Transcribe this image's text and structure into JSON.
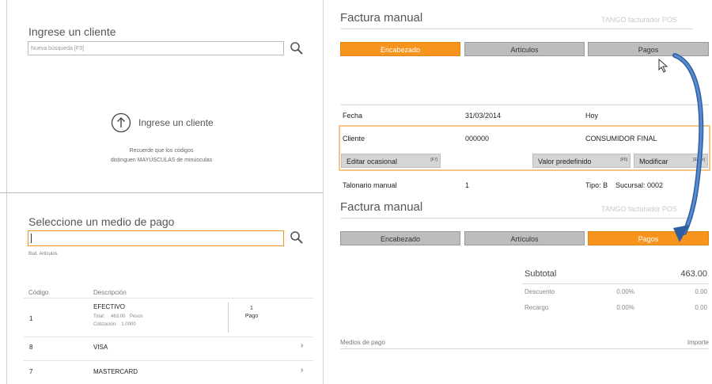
{
  "left_top": {
    "title": "Ingrese un cliente",
    "search_placeholder": "Nueva búsqueda [F3]",
    "prompt": "Ingrese un cliente",
    "hint_line1": "Recuerde que los códigos",
    "hint_line2": "distinguen MAYÚSCULAS de minúsculas"
  },
  "left_bottom": {
    "title": "Seleccione un medio de pago",
    "search_value": "",
    "filter_hint": "Bsd. Artículos",
    "columns": [
      "Código",
      "Descripción"
    ],
    "items": [
      {
        "code": "1",
        "name": "EFECTIVO",
        "total_label": "Total:",
        "total_value": "463.00",
        "currency": "Pesos",
        "rate_label": "Cotización:",
        "rate_value": "1.0000",
        "count": "1",
        "count_label": "Pago"
      },
      {
        "code": "8",
        "name": "VISA",
        "chevron": "›"
      },
      {
        "code": "7",
        "name": "MASTERCARD",
        "chevron": "›"
      }
    ]
  },
  "top_window": {
    "title": "Factura manual",
    "brand": "TANGO facturador POS",
    "tabs": [
      "Encabezado",
      "Artículos",
      "Pagos"
    ],
    "active_tab": 0,
    "fecha_label": "Fecha",
    "fecha_value": "31/03/2014",
    "fecha_hint": "Hoy",
    "cliente_label": "Cliente",
    "cliente_code": "000000",
    "cliente_name": "CONSUMIDOR FINAL",
    "btn_editar": "Editar ocasional",
    "btn_editar_key": "[F7]",
    "btn_valor": "Valor predefinido",
    "btn_valor_key": "[F5]",
    "btn_modificar": "Modificar",
    "btn_modificar_key": "[Enter]",
    "talonario_label": "Talonario manual",
    "talonario_value": "1",
    "tipo": "Tipo: B",
    "sucursal": "Sucursal: 0002"
  },
  "bottom_window": {
    "title": "Factura manual",
    "brand": "TANGO facturador POS",
    "tabs": [
      "Encabezado",
      "Artículos",
      "Pagos"
    ],
    "active_tab": 2,
    "subtotal_label": "Subtotal",
    "subtotal_value": "463.00",
    "descuento_label": "Descuento",
    "descuento_pct": "0.00%",
    "descuento_value": "0.00",
    "recargo_label": "Recargo",
    "recargo_pct": "0.00%",
    "recargo_value": "0.00",
    "medios_label": "Medios de pago",
    "importe_label": "Importe"
  },
  "colors": {
    "accent": "#f7941d",
    "tab_gray": "#bdbdbd",
    "arrow": "#3a6fb5"
  }
}
